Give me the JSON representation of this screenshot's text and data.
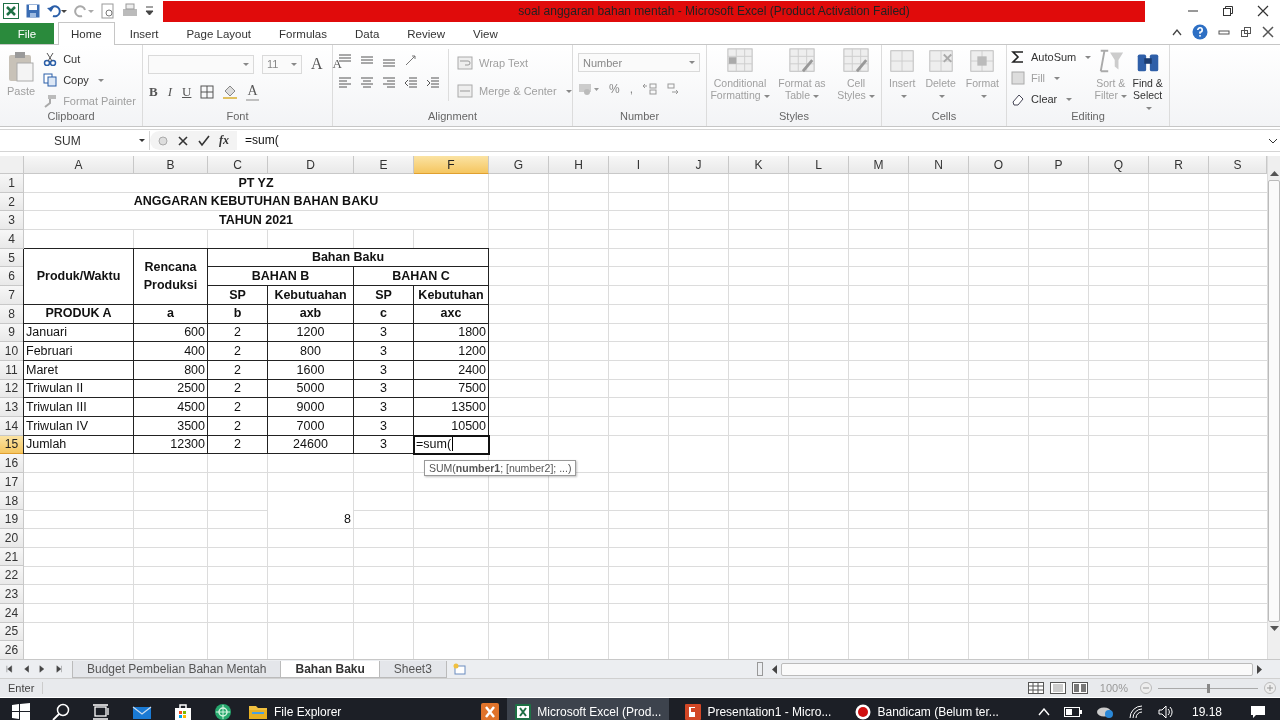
{
  "title_bar": {
    "title": "soal anggaran bahan mentah - Microsoft Excel (Product Activation Failed)"
  },
  "ribbon_tabs": [
    {
      "label": "File",
      "kind": "backstage",
      "selected": false
    },
    {
      "label": "Home",
      "kind": "tab",
      "selected": true
    },
    {
      "label": "Insert",
      "kind": "tab",
      "selected": false
    },
    {
      "label": "Page Layout",
      "kind": "tab",
      "selected": false
    },
    {
      "label": "Formulas",
      "kind": "tab",
      "selected": false
    },
    {
      "label": "Data",
      "kind": "tab",
      "selected": false
    },
    {
      "label": "Review",
      "kind": "tab",
      "selected": false
    },
    {
      "label": "View",
      "kind": "tab",
      "selected": false
    }
  ],
  "ribbon": {
    "clipboard": {
      "label": "Clipboard",
      "paste": {
        "label": "Paste",
        "disabled": true
      },
      "cut": {
        "label": "Cut",
        "disabled": false
      },
      "copy": {
        "label": "Copy",
        "disabled": false
      },
      "format_painter": {
        "label": "Format Painter",
        "disabled": true
      }
    },
    "font": {
      "label": "Font",
      "size": "11",
      "grow": "A",
      "shrink": "A",
      "bold": "B",
      "italic": "I",
      "underline": "U",
      "font_color": "A"
    },
    "alignment": {
      "label": "Alignment",
      "wrap_text": {
        "label": "Wrap Text",
        "disabled": true
      },
      "merge": {
        "label": "Merge & Center",
        "disabled": true
      }
    },
    "number": {
      "label": "Number",
      "format": "Number",
      "percent": "%",
      "comma": ","
    },
    "styles": {
      "label": "Styles",
      "buttons": [
        {
          "label": "Conditional Formatting",
          "disabled": true
        },
        {
          "label": "Format as Table",
          "disabled": true
        },
        {
          "label": "Cell Styles",
          "disabled": true
        }
      ]
    },
    "cells": {
      "label": "Cells",
      "buttons": [
        {
          "label": "Insert",
          "disabled": true
        },
        {
          "label": "Delete",
          "disabled": true
        },
        {
          "label": "Format",
          "disabled": true
        }
      ]
    },
    "editing": {
      "label": "Editing",
      "small": [
        {
          "label": "AutoSum",
          "disabled": false
        },
        {
          "label": "Fill",
          "disabled": true
        },
        {
          "label": "Clear",
          "disabled": false
        }
      ],
      "large": [
        {
          "label": "Sort & Filter",
          "disabled": true
        },
        {
          "label": "Find & Select",
          "disabled": false
        }
      ]
    }
  },
  "formula_bar": {
    "name_box": "SUM",
    "function_button": "fx",
    "formula": "=sum("
  },
  "sheet": {
    "columns": [
      {
        "label": "A",
        "selected": false
      },
      {
        "label": "B",
        "selected": false
      },
      {
        "label": "C",
        "selected": false
      },
      {
        "label": "D",
        "selected": false
      },
      {
        "label": "E",
        "selected": false
      },
      {
        "label": "F",
        "selected": true
      },
      {
        "label": "G",
        "selected": false
      },
      {
        "label": "H",
        "selected": false
      },
      {
        "label": "I",
        "selected": false
      },
      {
        "label": "J",
        "selected": false
      },
      {
        "label": "K",
        "selected": false
      },
      {
        "label": "L",
        "selected": false
      },
      {
        "label": "M",
        "selected": false
      },
      {
        "label": "N",
        "selected": false
      },
      {
        "label": "O",
        "selected": false
      },
      {
        "label": "P",
        "selected": false
      },
      {
        "label": "Q",
        "selected": false
      },
      {
        "label": "R",
        "selected": false
      },
      {
        "label": "S",
        "selected": false
      }
    ],
    "rows": [
      {
        "number": "1",
        "selected": false,
        "cells": {
          "A": "PT YZ"
        }
      },
      {
        "number": "2",
        "selected": false,
        "cells": {
          "A": "ANGGARAN KEBUTUHAN BAHAN BAKU"
        }
      },
      {
        "number": "3",
        "selected": false,
        "cells": {
          "A": "TAHUN 2021"
        }
      },
      {
        "number": "4",
        "selected": false
      },
      {
        "number": "5",
        "selected": false,
        "cells": {
          "A": "Produk/Waktu",
          "B": "Rencana Produksi",
          "C": "Bahan Baku"
        }
      },
      {
        "number": "6",
        "selected": false,
        "cells": {
          "C": "BAHAN B",
          "E": "BAHAN C"
        }
      },
      {
        "number": "7",
        "selected": false,
        "cells": {
          "C": "SP",
          "D": "Kebutuahan",
          "E": "SP",
          "F": "Kebutuhan"
        }
      },
      {
        "number": "8",
        "selected": false,
        "cells": {
          "A": "PRODUK A",
          "B": "a",
          "C": "b",
          "D": "axb",
          "E": "c",
          "F": "axc"
        }
      },
      {
        "number": "9",
        "selected": false,
        "cells": {
          "A": "Januari",
          "B": "600",
          "C": "2",
          "D": "1200",
          "E": "3",
          "F": "1800"
        }
      },
      {
        "number": "10",
        "selected": false,
        "cells": {
          "A": "Februari",
          "B": "400",
          "C": "2",
          "D": "800",
          "E": "3",
          "F": "1200"
        }
      },
      {
        "number": "11",
        "selected": false,
        "cells": {
          "A": "Maret",
          "B": "800",
          "C": "2",
          "D": "1600",
          "E": "3",
          "F": "2400"
        }
      },
      {
        "number": "12",
        "selected": false,
        "cells": {
          "A": "Triwulan II",
          "B": "2500",
          "C": "2",
          "D": "5000",
          "E": "3",
          "F": "7500"
        }
      },
      {
        "number": "13",
        "selected": false,
        "cells": {
          "A": "Triwulan III",
          "B": "4500",
          "C": "2",
          "D": "9000",
          "E": "3",
          "F": "13500"
        }
      },
      {
        "number": "14",
        "selected": false,
        "cells": {
          "A": "Triwulan IV",
          "B": "3500",
          "C": "2",
          "D": "7000",
          "E": "3",
          "F": "10500"
        }
      },
      {
        "number": "15",
        "selected": true,
        "cells": {
          "A": "Jumlah",
          "B": "12300",
          "C": "2",
          "D": "24600",
          "E": "3",
          "F": "=sum("
        }
      },
      {
        "number": "16",
        "selected": false
      },
      {
        "number": "17",
        "selected": false
      },
      {
        "number": "18",
        "selected": false
      },
      {
        "number": "19",
        "selected": false,
        "cells": {
          "D": "8"
        }
      },
      {
        "number": "20",
        "selected": false
      },
      {
        "number": "21",
        "selected": false
      },
      {
        "number": "22",
        "selected": false
      },
      {
        "number": "23",
        "selected": false
      },
      {
        "number": "24",
        "selected": false
      },
      {
        "number": "25",
        "selected": false
      },
      {
        "number": "26",
        "selected": false
      }
    ],
    "tooltip": "SUM(**number1**; [number2]; ...)"
  },
  "sheet_tabs": [
    {
      "label": "Budget Pembelian Bahan Mentah",
      "selected": false
    },
    {
      "label": "Bahan Baku",
      "selected": true
    },
    {
      "label": "Sheet3",
      "selected": false
    }
  ],
  "status_bar": {
    "mode": "Enter",
    "zoom": "100%",
    "zoom_slider": {
      "level": 0.5
    }
  },
  "taskbar": {
    "apps": [
      {
        "label": "File Explorer",
        "active": false
      },
      {
        "label": "Microsoft Excel (Prod...",
        "active": true
      },
      {
        "label": "Presentation1 - Micro...",
        "active": false
      },
      {
        "label": "Bandicam (Belum ter...",
        "active": false
      }
    ],
    "clock": "19.18"
  }
}
